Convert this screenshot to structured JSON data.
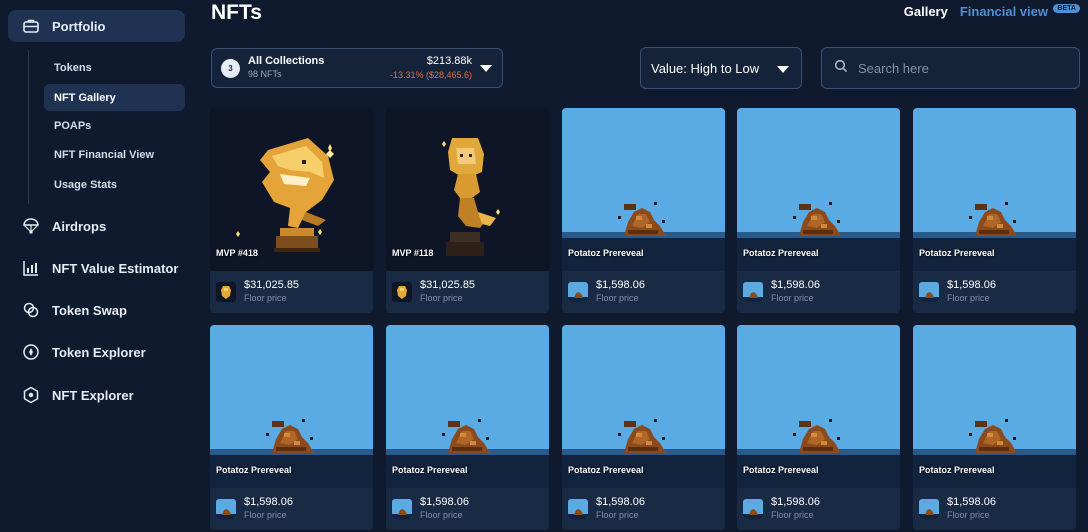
{
  "sidebar": {
    "main_items": [
      {
        "label": "Portfolio",
        "icon": "briefcase-icon"
      },
      {
        "label": "Airdrops",
        "icon": "parachute-icon"
      },
      {
        "label": "NFT Value Estimator",
        "icon": "bar-chart-icon"
      },
      {
        "label": "Token Swap",
        "icon": "swap-icon"
      },
      {
        "label": "Token Explorer",
        "icon": "compass-icon"
      },
      {
        "label": "NFT Explorer",
        "icon": "hexagon-icon"
      }
    ],
    "sub_items": [
      {
        "label": "Tokens"
      },
      {
        "label": "NFT Gallery"
      },
      {
        "label": "POAPs"
      },
      {
        "label": "NFT Financial View"
      },
      {
        "label": "Usage Stats"
      }
    ]
  },
  "header": {
    "title": "NFTs",
    "tabs": [
      {
        "label": "Gallery"
      },
      {
        "label": "Financial view",
        "badge": "BETA"
      }
    ]
  },
  "collection": {
    "count": "3",
    "title": "All Collections",
    "nft_count": "98 NFTs",
    "total": "$213.88k",
    "change": "-13.31% ($28,465.6)"
  },
  "sort": {
    "value": "Value: High to Low"
  },
  "search": {
    "placeholder": "Search here"
  },
  "cards": [
    {
      "name": "MVP #418",
      "price": "$31,025.85",
      "floor_label": "Floor price",
      "kind": "shark"
    },
    {
      "name": "MVP #118",
      "price": "$31,025.85",
      "floor_label": "Floor price",
      "kind": "mermaid"
    },
    {
      "name": "Potatoz Prereveal",
      "price": "$1,598.06",
      "floor_label": "Floor price",
      "kind": "potato"
    },
    {
      "name": "Potatoz Prereveal",
      "price": "$1,598.06",
      "floor_label": "Floor price",
      "kind": "potato"
    },
    {
      "name": "Potatoz Prereveal",
      "price": "$1,598.06",
      "floor_label": "Floor price",
      "kind": "potato"
    },
    {
      "name": "Potatoz Prereveal",
      "price": "$1,598.06",
      "floor_label": "Floor price",
      "kind": "potato"
    },
    {
      "name": "Potatoz Prereveal",
      "price": "$1,598.06",
      "floor_label": "Floor price",
      "kind": "potato"
    },
    {
      "name": "Potatoz Prereveal",
      "price": "$1,598.06",
      "floor_label": "Floor price",
      "kind": "potato"
    },
    {
      "name": "Potatoz Prereveal",
      "price": "$1,598.06",
      "floor_label": "Floor price",
      "kind": "potato"
    },
    {
      "name": "Potatoz Prereveal",
      "price": "$1,598.06",
      "floor_label": "Floor price",
      "kind": "potato"
    }
  ],
  "colors": {
    "background": "#0f1a2e",
    "card": "#192a45",
    "accent": "#4f8fd6",
    "negative": "#e0714d",
    "potato_sky": "#5aabe3",
    "gold": "#e0a83a"
  }
}
